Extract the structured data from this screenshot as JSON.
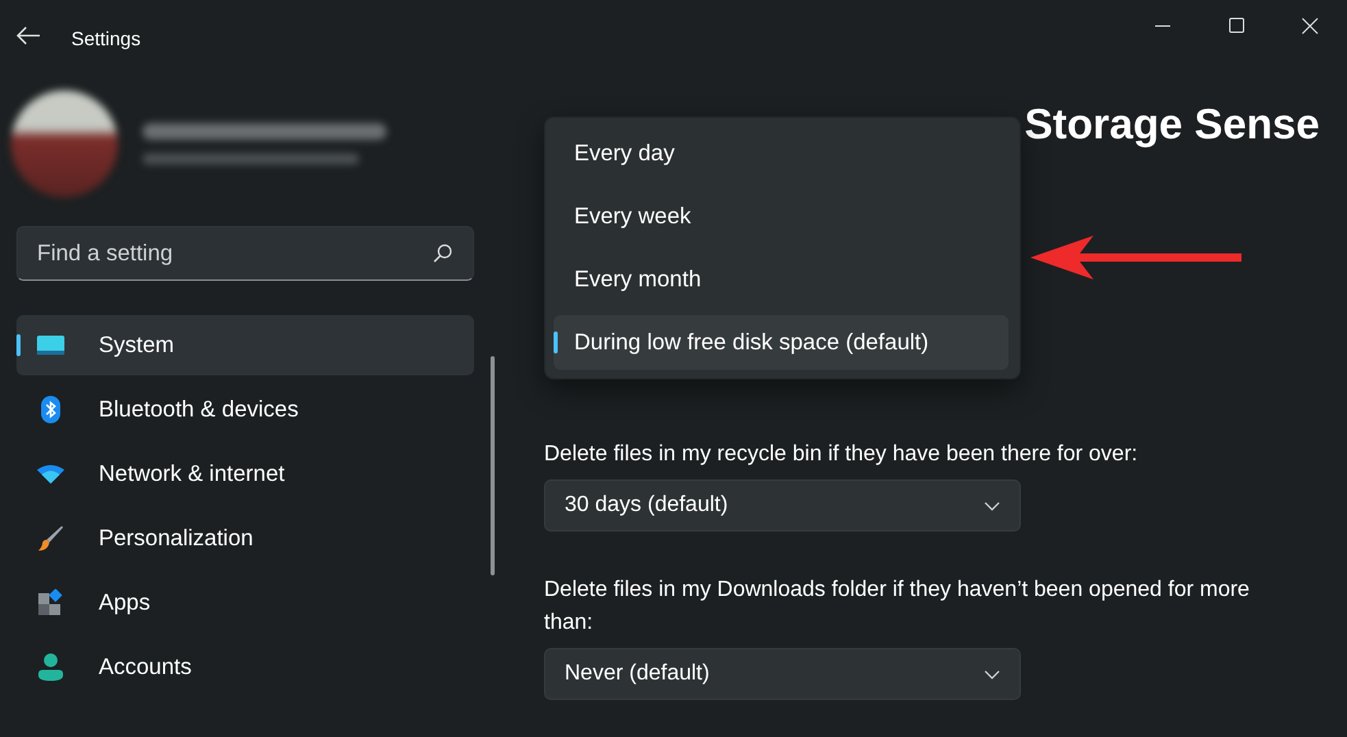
{
  "window": {
    "title": "Settings"
  },
  "search": {
    "placeholder": "Find a setting"
  },
  "sidebar": {
    "items": [
      {
        "label": "System",
        "selected": true
      },
      {
        "label": "Bluetooth & devices",
        "selected": false
      },
      {
        "label": "Network & internet",
        "selected": false
      },
      {
        "label": "Personalization",
        "selected": false
      },
      {
        "label": "Apps",
        "selected": false
      },
      {
        "label": "Accounts",
        "selected": false
      }
    ]
  },
  "header": {
    "title": "Storage Sense"
  },
  "dropdown_menu": {
    "options": [
      {
        "label": "Every day",
        "selected": false
      },
      {
        "label": "Every week",
        "selected": false
      },
      {
        "label": "Every month",
        "selected": false
      },
      {
        "label": "During low free disk space (default)",
        "selected": true
      }
    ]
  },
  "settings": [
    {
      "label": "Delete files in my recycle bin if they have been there for over:",
      "value": "30 days (default)"
    },
    {
      "label": "Delete files in my Downloads folder if they haven’t been opened for more than:",
      "value": "Never (default)"
    }
  ]
}
